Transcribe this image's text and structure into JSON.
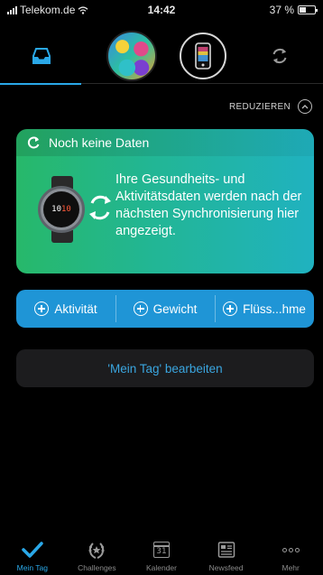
{
  "status_bar": {
    "carrier": "Telekom.de",
    "time": "14:42",
    "battery_text": "37 %",
    "battery_level": 0.37
  },
  "top_nav": {
    "items": [
      {
        "icon": "inbox-icon",
        "active": true
      },
      {
        "icon": "avatar"
      },
      {
        "icon": "device-icon"
      },
      {
        "icon": "sync-icon"
      }
    ],
    "accent_color": "#2aa8e8"
  },
  "reduce": {
    "label": "REDUZIEREN"
  },
  "health_card": {
    "header": "Noch keine Daten",
    "watch_time": "10:10",
    "message": "Ihre Gesundheits- und Aktivitätsdaten werden nach der nächsten Synchronisierung hier angezeigt.",
    "gradient": [
      "#27b86a",
      "#20b2c0"
    ]
  },
  "quick_add": {
    "buttons": [
      {
        "label": "Aktivität"
      },
      {
        "label": "Gewicht"
      },
      {
        "label": "Flüss...hme"
      }
    ],
    "color": "#1f95d6"
  },
  "edit_day": {
    "label": "'Mein Tag' bearbeiten"
  },
  "tab_bar": {
    "tabs": [
      {
        "label": "Mein Tag",
        "icon": "check-icon",
        "active": true
      },
      {
        "label": "Challenges",
        "icon": "laurel-icon"
      },
      {
        "label": "Kalender",
        "icon": "calendar-icon",
        "day": "31"
      },
      {
        "label": "Newsfeed",
        "icon": "newsfeed-icon"
      },
      {
        "label": "Mehr",
        "icon": "more-icon"
      }
    ]
  }
}
